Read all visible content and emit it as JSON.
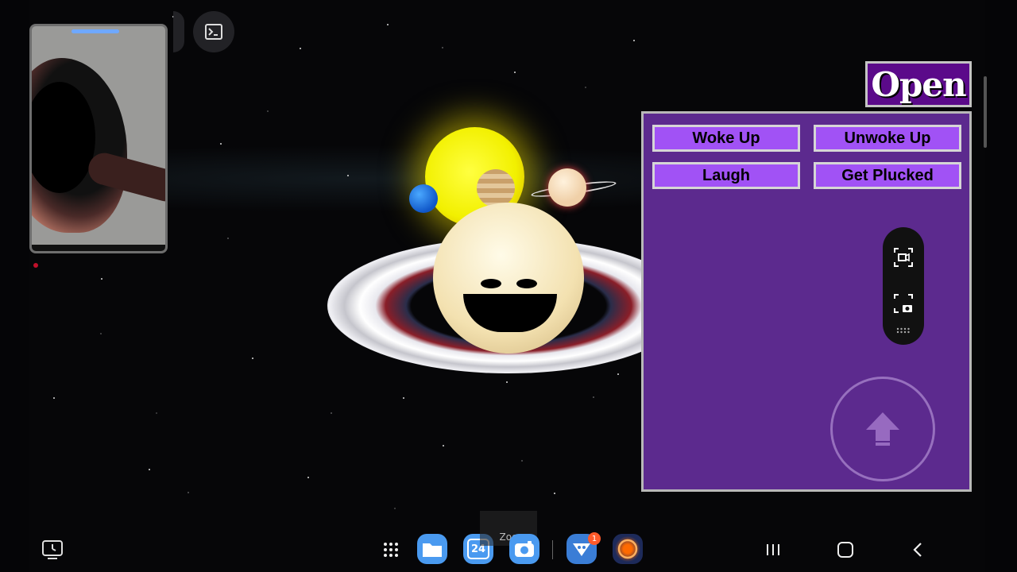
{
  "game": {
    "open_label": "Open",
    "panel": {
      "buttons": [
        {
          "label": "Woke Up"
        },
        {
          "label": "Unwoke Up"
        },
        {
          "label": "Laugh"
        },
        {
          "label": "Get Plucked"
        }
      ]
    },
    "colors": {
      "panel_bg": "#5c2a8e",
      "button_bg": "#a152f5",
      "open_bg": "#5b0a8a"
    }
  },
  "screen_recorder": {
    "icons": [
      "screenshot-record-icon",
      "screen-capture-icon",
      "drag-dots-icon"
    ]
  },
  "taskbar": {
    "apps": [
      {
        "name": "apps-grid-icon"
      },
      {
        "name": "files-icon"
      },
      {
        "name": "calendar-icon",
        "label": "24"
      },
      {
        "name": "camera-icon"
      },
      {
        "name": "game-app-icon",
        "badge": "1"
      },
      {
        "name": "browser-app-icon"
      }
    ],
    "zoom_tooltip": "Zoo"
  }
}
